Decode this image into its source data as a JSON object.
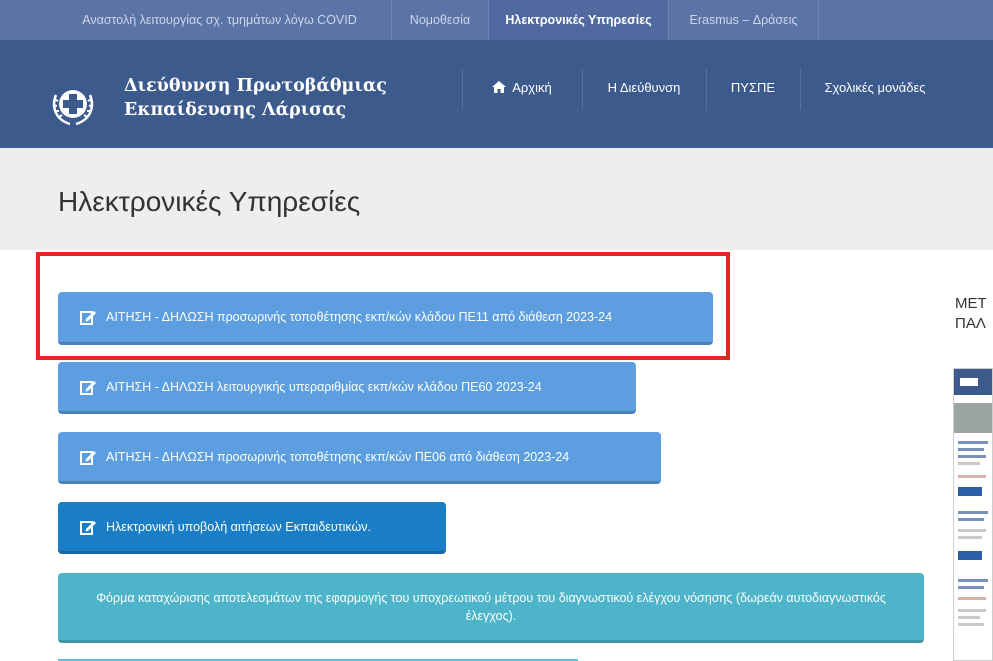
{
  "topbar": {
    "items": [
      "Αναστολή λειτουργίας σχ. τμημάτων λόγω COVID",
      "Νομοθεσία",
      "Ηλεκτρονικές Υπηρεσίες",
      "Erasmus – Δράσεις"
    ]
  },
  "header": {
    "brand_line1": "Διεύθυνση Πρωτοβάθμιας",
    "brand_line2": "Εκπαίδευσης Λάρισας",
    "nav": [
      "Αρχική",
      "Η Διεύθυνση",
      "ΠΥΣΠΕ",
      "Σχολικές μονάδες"
    ]
  },
  "page": {
    "title": "Ηλεκτρονικές Υπηρεσίες"
  },
  "services": [
    "ΑΙΤΗΣΗ - ΔΗΛΩΣΗ προσωρινής τοποθέτησης εκπ/κών κλάδου ΠΕ11 από διάθεση 2023-24",
    "ΑΙΤΗΣΗ - ΔΗΛΩΣΗ λειτουργικής υπεραριθμίας εκπ/κών κλάδου ΠΕ60 2023-24",
    "ΑΙΤΗΣΗ - ΔΗΛΩΣΗ προσωρινής τοποθέτησης εκπ/κών ΠΕ06 από διάθεση 2023-24",
    "Ηλεκτρονική υποβολή αιτήσεων Εκπαιδευτικών.",
    "Φόρμα καταχώρισης αποτελεσμάτων της εφαρμογής του υποχρεωτικού μέτρου του διαγνωστικού ελέγχου νόσησης (δωρεάν αυτοδιαγνωστικός έλεγχος)."
  ],
  "sidebar": {
    "line1": "ΜΕΤ",
    "line2": "ΠΑΛ"
  },
  "colors": {
    "highlight": "#e02826",
    "header": "#3d5a8d"
  }
}
